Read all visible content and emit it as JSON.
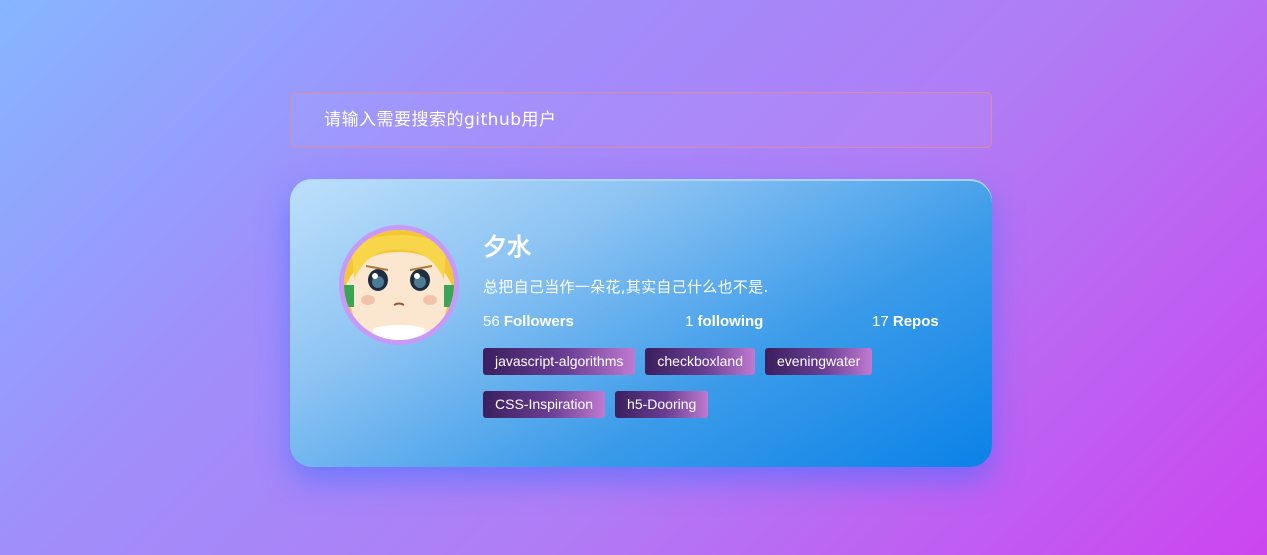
{
  "search": {
    "placeholder": "请输入需要搜索的github用户",
    "value": ""
  },
  "profile": {
    "name": "夕水",
    "bio": "总把自己当作一朵花,其实自己什么也不是.",
    "followers_count": "56",
    "followers_label": "Followers",
    "following_count": "1",
    "following_label": "following",
    "repos_count": "17",
    "repos_label": "Repos"
  },
  "repos": [
    "javascript-algorithms",
    "checkboxland",
    "eveningwater",
    "CSS-Inspiration",
    "h5-Dooring"
  ],
  "colors": {
    "card_start": "#bde0fb",
    "card_end": "#0b82e8",
    "avatar_border": "#c79af7",
    "tag_start": "#3b1f5e",
    "tag_end": "#c07ad0"
  }
}
